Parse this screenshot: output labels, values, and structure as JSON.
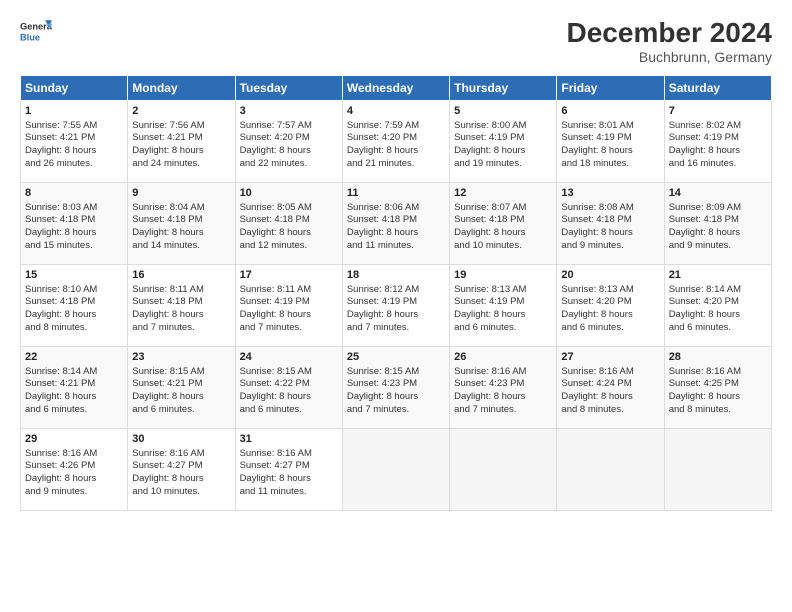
{
  "header": {
    "logo_line1": "General",
    "logo_line2": "Blue",
    "title": "December 2024",
    "subtitle": "Buchbrunn, Germany"
  },
  "days_of_week": [
    "Sunday",
    "Monday",
    "Tuesday",
    "Wednesday",
    "Thursday",
    "Friday",
    "Saturday"
  ],
  "weeks": [
    [
      {
        "day": 1,
        "lines": [
          "Sunrise: 7:55 AM",
          "Sunset: 4:21 PM",
          "Daylight: 8 hours",
          "and 26 minutes."
        ]
      },
      {
        "day": 2,
        "lines": [
          "Sunrise: 7:56 AM",
          "Sunset: 4:21 PM",
          "Daylight: 8 hours",
          "and 24 minutes."
        ]
      },
      {
        "day": 3,
        "lines": [
          "Sunrise: 7:57 AM",
          "Sunset: 4:20 PM",
          "Daylight: 8 hours",
          "and 22 minutes."
        ]
      },
      {
        "day": 4,
        "lines": [
          "Sunrise: 7:59 AM",
          "Sunset: 4:20 PM",
          "Daylight: 8 hours",
          "and 21 minutes."
        ]
      },
      {
        "day": 5,
        "lines": [
          "Sunrise: 8:00 AM",
          "Sunset: 4:19 PM",
          "Daylight: 8 hours",
          "and 19 minutes."
        ]
      },
      {
        "day": 6,
        "lines": [
          "Sunrise: 8:01 AM",
          "Sunset: 4:19 PM",
          "Daylight: 8 hours",
          "and 18 minutes."
        ]
      },
      {
        "day": 7,
        "lines": [
          "Sunrise: 8:02 AM",
          "Sunset: 4:19 PM",
          "Daylight: 8 hours",
          "and 16 minutes."
        ]
      }
    ],
    [
      {
        "day": 8,
        "lines": [
          "Sunrise: 8:03 AM",
          "Sunset: 4:18 PM",
          "Daylight: 8 hours",
          "and 15 minutes."
        ]
      },
      {
        "day": 9,
        "lines": [
          "Sunrise: 8:04 AM",
          "Sunset: 4:18 PM",
          "Daylight: 8 hours",
          "and 14 minutes."
        ]
      },
      {
        "day": 10,
        "lines": [
          "Sunrise: 8:05 AM",
          "Sunset: 4:18 PM",
          "Daylight: 8 hours",
          "and 12 minutes."
        ]
      },
      {
        "day": 11,
        "lines": [
          "Sunrise: 8:06 AM",
          "Sunset: 4:18 PM",
          "Daylight: 8 hours",
          "and 11 minutes."
        ]
      },
      {
        "day": 12,
        "lines": [
          "Sunrise: 8:07 AM",
          "Sunset: 4:18 PM",
          "Daylight: 8 hours",
          "and 10 minutes."
        ]
      },
      {
        "day": 13,
        "lines": [
          "Sunrise: 8:08 AM",
          "Sunset: 4:18 PM",
          "Daylight: 8 hours",
          "and 9 minutes."
        ]
      },
      {
        "day": 14,
        "lines": [
          "Sunrise: 8:09 AM",
          "Sunset: 4:18 PM",
          "Daylight: 8 hours",
          "and 9 minutes."
        ]
      }
    ],
    [
      {
        "day": 15,
        "lines": [
          "Sunrise: 8:10 AM",
          "Sunset: 4:18 PM",
          "Daylight: 8 hours",
          "and 8 minutes."
        ]
      },
      {
        "day": 16,
        "lines": [
          "Sunrise: 8:11 AM",
          "Sunset: 4:18 PM",
          "Daylight: 8 hours",
          "and 7 minutes."
        ]
      },
      {
        "day": 17,
        "lines": [
          "Sunrise: 8:11 AM",
          "Sunset: 4:19 PM",
          "Daylight: 8 hours",
          "and 7 minutes."
        ]
      },
      {
        "day": 18,
        "lines": [
          "Sunrise: 8:12 AM",
          "Sunset: 4:19 PM",
          "Daylight: 8 hours",
          "and 7 minutes."
        ]
      },
      {
        "day": 19,
        "lines": [
          "Sunrise: 8:13 AM",
          "Sunset: 4:19 PM",
          "Daylight: 8 hours",
          "and 6 minutes."
        ]
      },
      {
        "day": 20,
        "lines": [
          "Sunrise: 8:13 AM",
          "Sunset: 4:20 PM",
          "Daylight: 8 hours",
          "and 6 minutes."
        ]
      },
      {
        "day": 21,
        "lines": [
          "Sunrise: 8:14 AM",
          "Sunset: 4:20 PM",
          "Daylight: 8 hours",
          "and 6 minutes."
        ]
      }
    ],
    [
      {
        "day": 22,
        "lines": [
          "Sunrise: 8:14 AM",
          "Sunset: 4:21 PM",
          "Daylight: 8 hours",
          "and 6 minutes."
        ]
      },
      {
        "day": 23,
        "lines": [
          "Sunrise: 8:15 AM",
          "Sunset: 4:21 PM",
          "Daylight: 8 hours",
          "and 6 minutes."
        ]
      },
      {
        "day": 24,
        "lines": [
          "Sunrise: 8:15 AM",
          "Sunset: 4:22 PM",
          "Daylight: 8 hours",
          "and 6 minutes."
        ]
      },
      {
        "day": 25,
        "lines": [
          "Sunrise: 8:15 AM",
          "Sunset: 4:23 PM",
          "Daylight: 8 hours",
          "and 7 minutes."
        ]
      },
      {
        "day": 26,
        "lines": [
          "Sunrise: 8:16 AM",
          "Sunset: 4:23 PM",
          "Daylight: 8 hours",
          "and 7 minutes."
        ]
      },
      {
        "day": 27,
        "lines": [
          "Sunrise: 8:16 AM",
          "Sunset: 4:24 PM",
          "Daylight: 8 hours",
          "and 8 minutes."
        ]
      },
      {
        "day": 28,
        "lines": [
          "Sunrise: 8:16 AM",
          "Sunset: 4:25 PM",
          "Daylight: 8 hours",
          "and 8 minutes."
        ]
      }
    ],
    [
      {
        "day": 29,
        "lines": [
          "Sunrise: 8:16 AM",
          "Sunset: 4:26 PM",
          "Daylight: 8 hours",
          "and 9 minutes."
        ]
      },
      {
        "day": 30,
        "lines": [
          "Sunrise: 8:16 AM",
          "Sunset: 4:27 PM",
          "Daylight: 8 hours",
          "and 10 minutes."
        ]
      },
      {
        "day": 31,
        "lines": [
          "Sunrise: 8:16 AM",
          "Sunset: 4:27 PM",
          "Daylight: 8 hours",
          "and 11 minutes."
        ]
      },
      null,
      null,
      null,
      null
    ]
  ]
}
